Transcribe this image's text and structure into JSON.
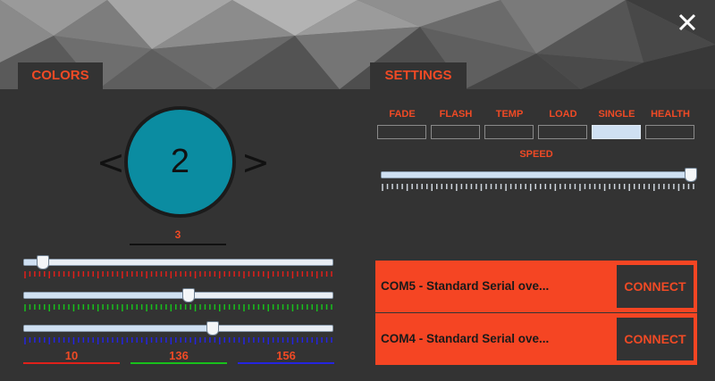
{
  "tabs": {
    "colors": "COLORS",
    "settings": "SETTINGS"
  },
  "colors": {
    "prev_symbol": "<",
    "next_symbol": ">",
    "current_index": "2",
    "count_label": "3",
    "red": {
      "value": "10",
      "level": 0.04,
      "color": "#e0201a"
    },
    "green": {
      "value": "136",
      "level": 0.53,
      "color": "#18c01c"
    },
    "blue": {
      "value": "156",
      "level": 0.61,
      "color": "#2424e0"
    }
  },
  "settings": {
    "modes": [
      {
        "label": "FADE",
        "active": false
      },
      {
        "label": "FLASH",
        "active": false
      },
      {
        "label": "TEMP",
        "active": false
      },
      {
        "label": "LOAD",
        "active": false
      },
      {
        "label": "SINGLE",
        "active": true
      },
      {
        "label": "HEALTH",
        "active": false
      }
    ],
    "speed_label": "SPEED",
    "speed_level": 1.0
  },
  "ports": [
    {
      "name": "COM5 - Standard Serial ove...",
      "button": "CONNECT"
    },
    {
      "name": "COM4 - Standard Serial ove...",
      "button": "CONNECT"
    }
  ],
  "accent_color": "#f04a25",
  "icons": {
    "close": "close-icon"
  }
}
